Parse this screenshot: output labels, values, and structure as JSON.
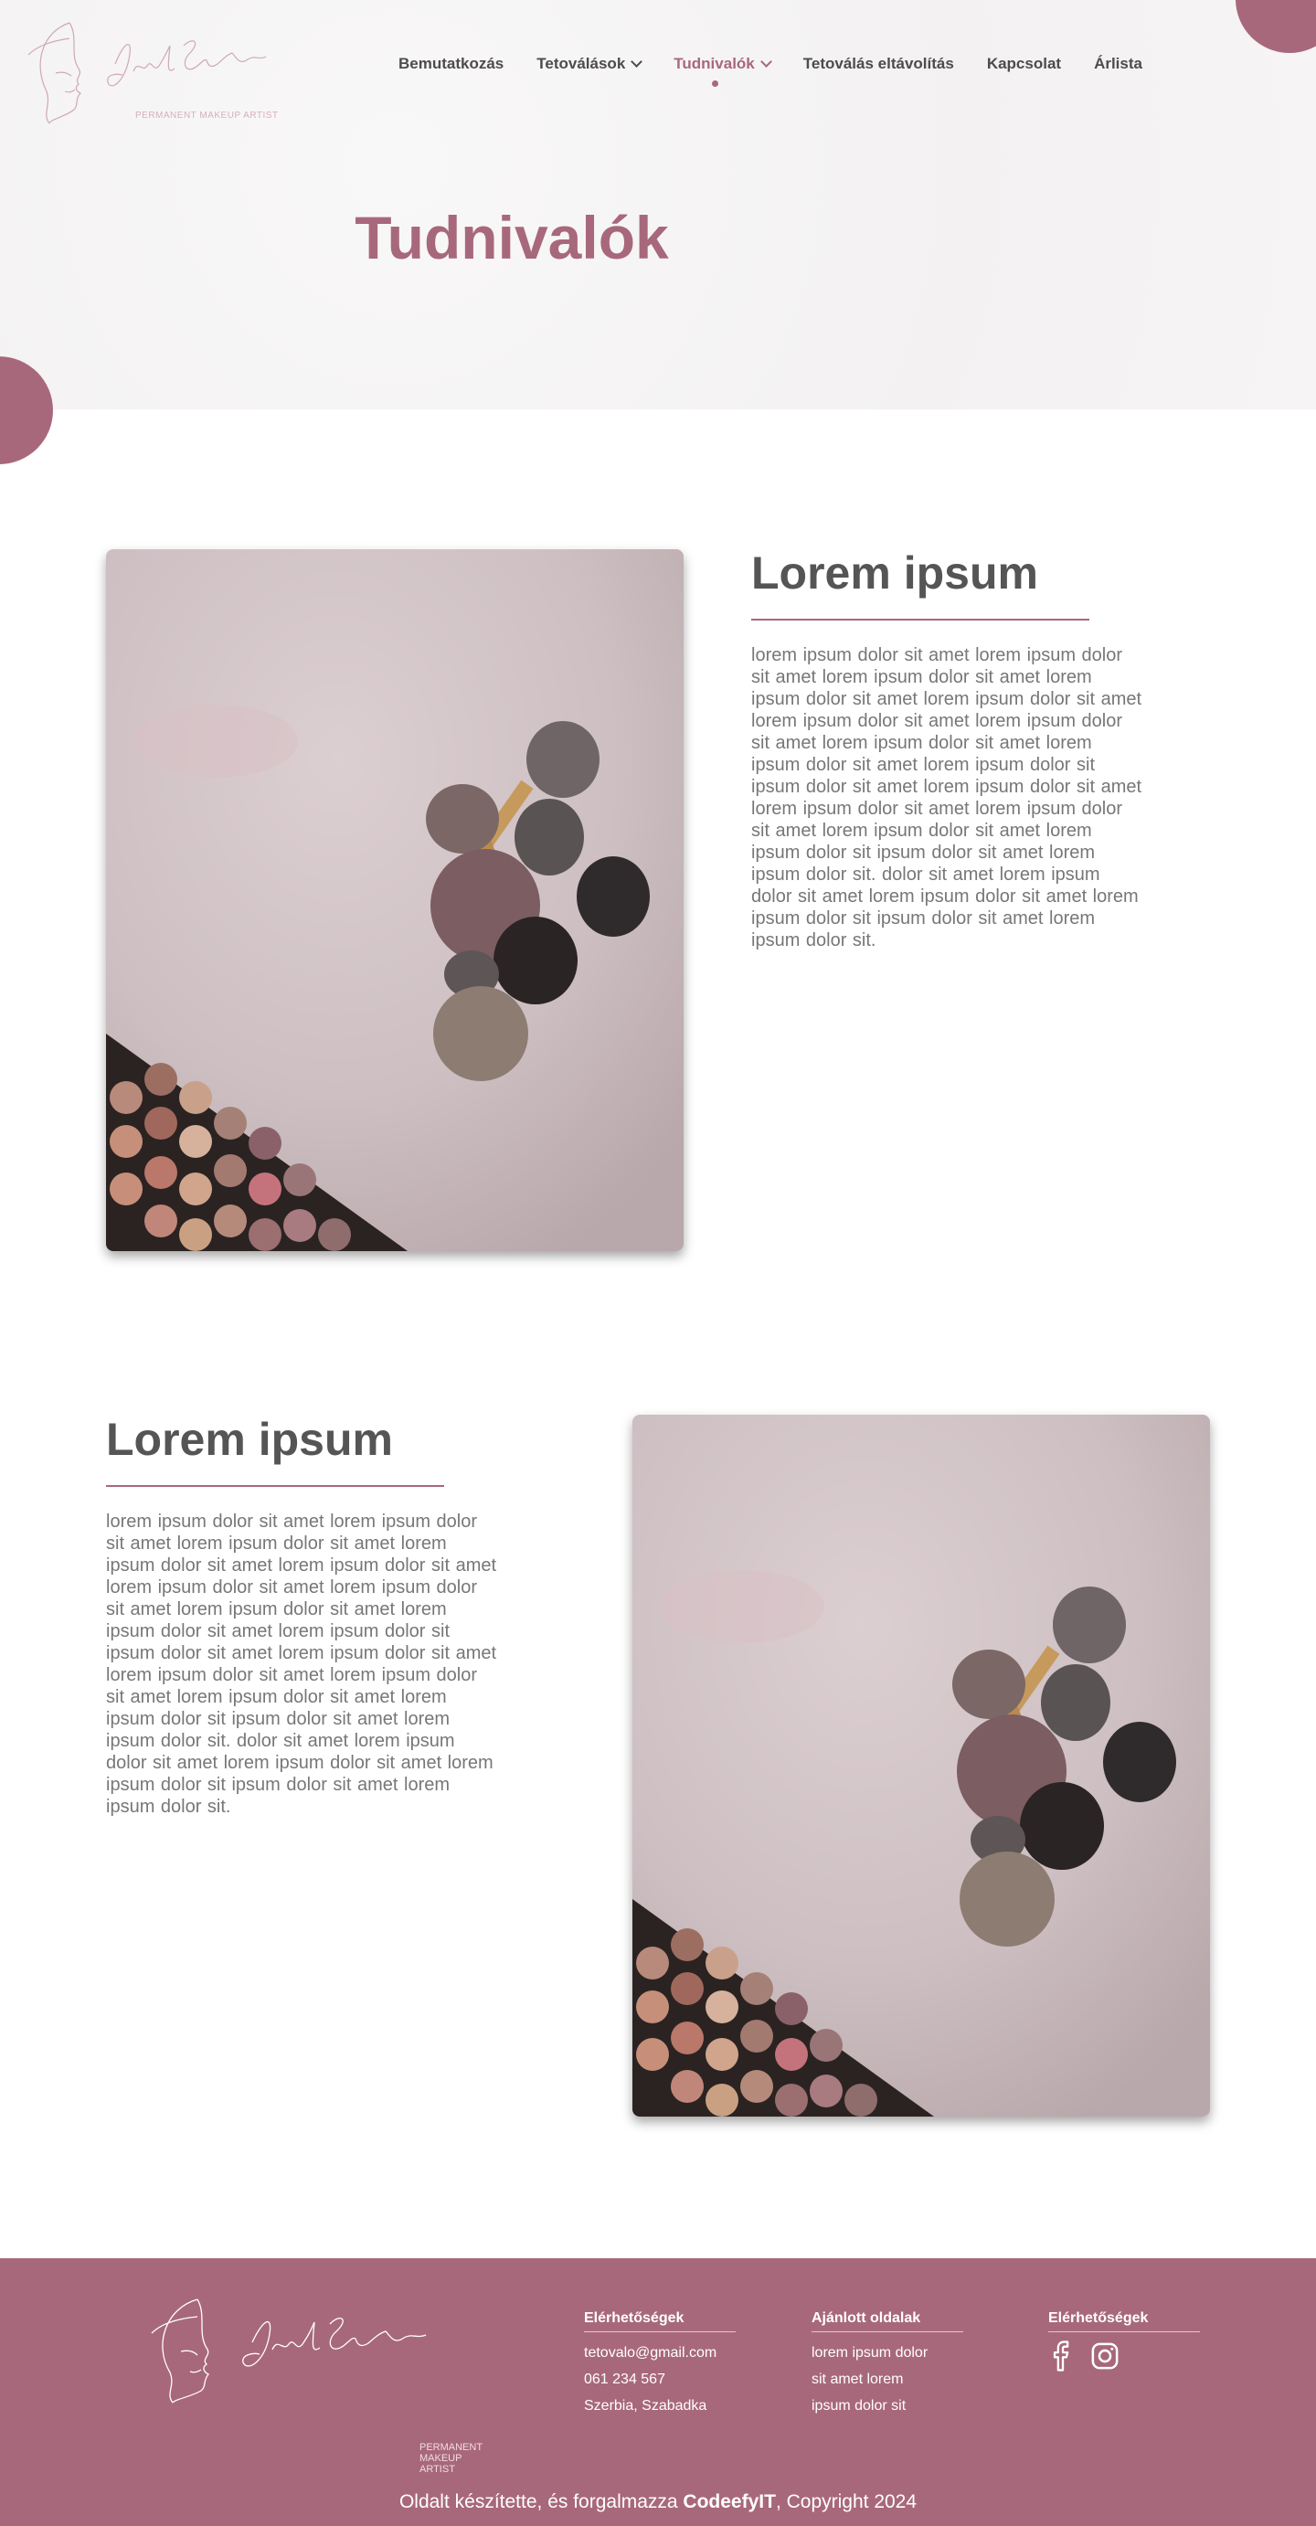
{
  "brand": {
    "caption": "PERMANENT MAKEUP ARTIST"
  },
  "nav": {
    "items": [
      {
        "label": "Bemutatkozás"
      },
      {
        "label": "Tetoválások"
      },
      {
        "label": "Tudnivalók"
      },
      {
        "label": "Tetoválás eltávolítás"
      },
      {
        "label": "Kapcsolat"
      },
      {
        "label": "Árlista"
      }
    ]
  },
  "hero": {
    "title": "Tudnivalók"
  },
  "sections": [
    {
      "heading": "Lorem ipsum",
      "body": "lorem ipsum dolor sit amet lorem ipsum dolor sit amet lorem ipsum dolor sit amet lorem ipsum dolor sit amet lorem ipsum dolor sit amet lorem ipsum dolor sit amet lorem ipsum dolor sit amet lorem ipsum dolor sit amet lorem ipsum dolor sit amet lorem ipsum dolor sit ipsum dolor sit amet lorem ipsum dolor sit amet lorem ipsum dolor sit amet lorem ipsum dolor sit amet lorem ipsum dolor sit amet lorem ipsum dolor sit ipsum dolor sit amet lorem ipsum dolor sit. dolor sit amet lorem ipsum dolor sit amet lorem ipsum dolor sit amet lorem ipsum dolor sit ipsum dolor sit amet lorem ipsum dolor sit."
    },
    {
      "heading": "Lorem ipsum",
      "body": "lorem ipsum dolor sit amet lorem ipsum dolor sit amet lorem ipsum dolor sit amet lorem ipsum dolor sit amet lorem ipsum dolor sit amet lorem ipsum dolor sit amet lorem ipsum dolor sit amet lorem ipsum dolor sit amet lorem ipsum dolor sit amet lorem ipsum dolor sit ipsum dolor sit amet lorem ipsum dolor sit amet lorem ipsum dolor sit amet lorem ipsum dolor sit amet lorem ipsum dolor sit amet lorem ipsum dolor sit ipsum dolor sit amet lorem ipsum dolor sit. dolor sit amet lorem ipsum dolor sit amet lorem ipsum dolor sit amet lorem ipsum dolor sit ipsum dolor sit amet lorem ipsum dolor sit."
    }
  ],
  "footer": {
    "contact": {
      "heading": "Elérhetőségek",
      "email": "tetovalo@gmail.com",
      "phone": "061 234 567",
      "address": "Szerbia, Szabadka"
    },
    "recommended": {
      "heading": "Ajánlott oldalak",
      "links": [
        "lorem ipsum dolor",
        "sit amet lorem",
        "ipsum dolor sit"
      ]
    },
    "social": {
      "heading": "Elérhetőségek",
      "icons": [
        "facebook-icon",
        "instagram-icon"
      ]
    },
    "copyright_prefix": "Oldalt készítette, és forgalmazza ",
    "copyright_brand": "CodeefyIT",
    "copyright_suffix": ", Copyright 2024"
  },
  "colors": {
    "accent": "#a8687c",
    "text": "#555555",
    "muted": "#777777",
    "hero_bg": "#f6f4f4"
  }
}
